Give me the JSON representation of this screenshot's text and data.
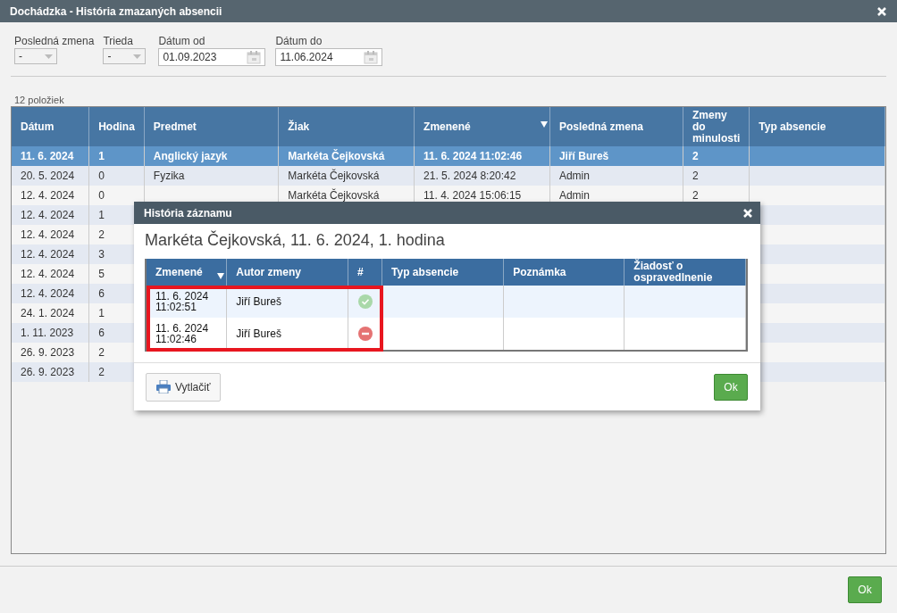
{
  "window": {
    "title": "Dochádzka - História zmazaných absencii"
  },
  "filters": [
    {
      "kind": "select",
      "label": "Posledná zmena",
      "value": "-"
    },
    {
      "kind": "select",
      "label": "Trieda",
      "value": "-"
    },
    {
      "kind": "date",
      "label": "Dátum od",
      "value": "01.09.2023"
    },
    {
      "kind": "date",
      "label": "Dátum do",
      "value": "11.06.2024"
    }
  ],
  "item_count": "12 položiek",
  "table": {
    "columns": [
      {
        "label": "Dátum",
        "sorted": false
      },
      {
        "label": "Hodina",
        "sorted": false
      },
      {
        "label": "Predmet",
        "sorted": false
      },
      {
        "label": "Žiak",
        "sorted": false
      },
      {
        "label": "Zmenené",
        "sorted": true
      },
      {
        "label": "Posledná zmena",
        "sorted": false
      },
      {
        "label": "Zmeny do minulosti",
        "sorted": false
      },
      {
        "label": "Typ absencie",
        "sorted": false
      }
    ],
    "rows": [
      {
        "selected": true,
        "cells": [
          "11. 6. 2024",
          "1",
          "Anglický jazyk",
          "Markéta Čejkovská",
          "11. 6. 2024 11:02:46",
          "Jiří Bureš",
          "2",
          ""
        ]
      },
      {
        "selected": false,
        "cells": [
          "20. 5. 2024",
          "0",
          "Fyzika",
          "Markéta Čejkovská",
          "21. 5. 2024 8:20:42",
          "Admin",
          "2",
          ""
        ]
      },
      {
        "selected": false,
        "cells": [
          "12. 4. 2024",
          "0",
          "",
          "Markéta Čejkovská",
          "11. 4. 2024 15:06:15",
          "Admin",
          "2",
          ""
        ]
      },
      {
        "selected": false,
        "cells": [
          "12. 4. 2024",
          "1"
        ]
      },
      {
        "selected": false,
        "cells": [
          "12. 4. 2024",
          "2"
        ]
      },
      {
        "selected": false,
        "cells": [
          "12. 4. 2024",
          "3"
        ]
      },
      {
        "selected": false,
        "cells": [
          "12. 4. 2024",
          "5"
        ]
      },
      {
        "selected": false,
        "cells": [
          "12. 4. 2024",
          "6"
        ]
      },
      {
        "selected": false,
        "cells": [
          "24. 1. 2024",
          "1"
        ]
      },
      {
        "selected": false,
        "cells": [
          "1. 11. 2023",
          "6"
        ]
      },
      {
        "selected": false,
        "cells": [
          "26. 9. 2023",
          "2"
        ]
      },
      {
        "selected": false,
        "cells": [
          "26. 9. 2023",
          "2"
        ]
      }
    ]
  },
  "footer": {
    "ok_button": "Ok"
  },
  "dialog": {
    "title": "História záznamu",
    "heading": "Markéta Čejkovská, 11. 6. 2024, 1. hodina",
    "columns": [
      {
        "label": "Zmenené",
        "sorted": true
      },
      {
        "label": "Autor zmeny",
        "sorted": false
      },
      {
        "label": "#",
        "sorted": false
      },
      {
        "label": "Typ absencie",
        "sorted": false
      },
      {
        "label": "Poznámka",
        "sorted": false
      },
      {
        "label": "Žiadosť o ospravedlnenie",
        "sorted": false
      }
    ],
    "rows": [
      {
        "changed": "11. 6. 2024 11:02:51",
        "author": "Jiří Bureš",
        "kind": "ok"
      },
      {
        "changed": "11. 6. 2024 11:02:46",
        "author": "Jiří Bureš",
        "kind": "removed"
      }
    ],
    "highlighted": true,
    "print_button": "Vytlačiť",
    "ok_button": "Ok"
  }
}
